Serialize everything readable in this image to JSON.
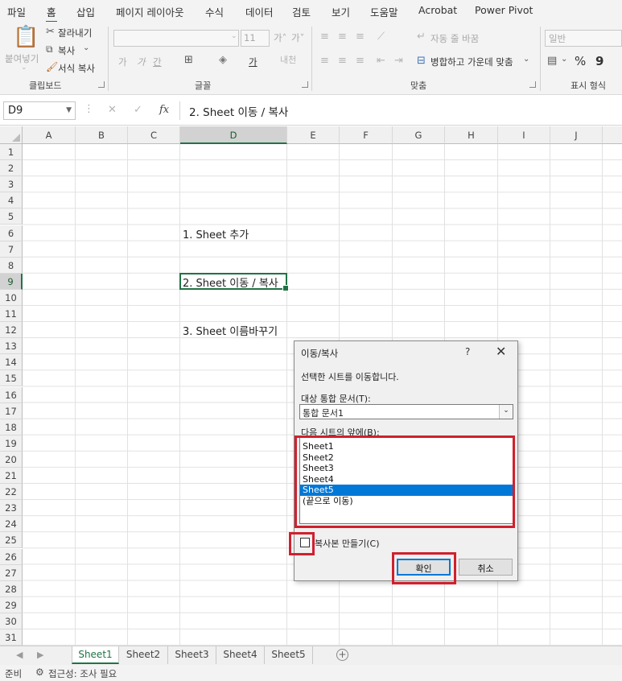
{
  "ribbon_tabs": [
    "파일",
    "홈",
    "삽입",
    "페이지 레이아웃",
    "수식",
    "데이터",
    "검토",
    "보기",
    "도움말",
    "Acrobat",
    "Power Pivot"
  ],
  "ribbon": {
    "clipboard": {
      "paste": "붙여넣기",
      "cut": "잘라내기",
      "copy": "복사",
      "format_painter": "서식 복사",
      "label": "클립보드"
    },
    "font": {
      "size": "11",
      "grow": "가˄",
      "shrink": "가˅",
      "bold": "가",
      "italic": "가",
      "underline": "간",
      "font_color": "가",
      "label": "글꼴"
    },
    "alignment": {
      "wrap": "자동 줄 바꿈",
      "merge": "병합하고 가운데 맞춤",
      "label": "맞춤"
    },
    "number": {
      "format": "일반",
      "percent": "%",
      "comma": "9",
      "label": "표시 형식"
    }
  },
  "formula_bar": {
    "name_box": "D9",
    "cancel": "✕",
    "enter": "✓",
    "fx": "fx",
    "value": "2. Sheet 이동 / 복사"
  },
  "columns": [
    "A",
    "B",
    "C",
    "D",
    "E",
    "F",
    "G",
    "H",
    "I",
    "J"
  ],
  "rows": [
    "1",
    "2",
    "3",
    "4",
    "5",
    "6",
    "7",
    "8",
    "9",
    "10",
    "11",
    "12",
    "13",
    "14",
    "15",
    "16",
    "17",
    "18",
    "19",
    "20",
    "21",
    "22",
    "23",
    "24",
    "25",
    "26",
    "27",
    "28",
    "29",
    "30",
    "31"
  ],
  "cells": {
    "d6": "1. Sheet 추가",
    "d9": "2. Sheet 이동 / 복사",
    "d12": "3. Sheet 이름바꾸기"
  },
  "sheet_tabs": [
    "Sheet1",
    "Sheet2",
    "Sheet3",
    "Sheet4",
    "Sheet5"
  ],
  "status": {
    "ready": "준비",
    "accessibility": "접근성: 조사 필요"
  },
  "dialog": {
    "title": "이동/복사",
    "help": "?",
    "close": "✕",
    "description": "선택한 시트를 이동합니다.",
    "workbook_label": "대상 통합 문서(T):",
    "workbook_value": "통합 문서1",
    "before_label": "다음 시트의 앞에(B):",
    "sheets": [
      "Sheet1",
      "Sheet2",
      "Sheet3",
      "Sheet4",
      "Sheet5",
      "(끝으로 이동)"
    ],
    "selected_sheet": "Sheet5",
    "copy_label": "복사본 만들기(C)",
    "copy_checked": false,
    "ok": "확인",
    "cancel": "취소"
  },
  "colors": {
    "accent": "#217346",
    "selection": "#0078d7",
    "highlight": "#d0202e"
  }
}
